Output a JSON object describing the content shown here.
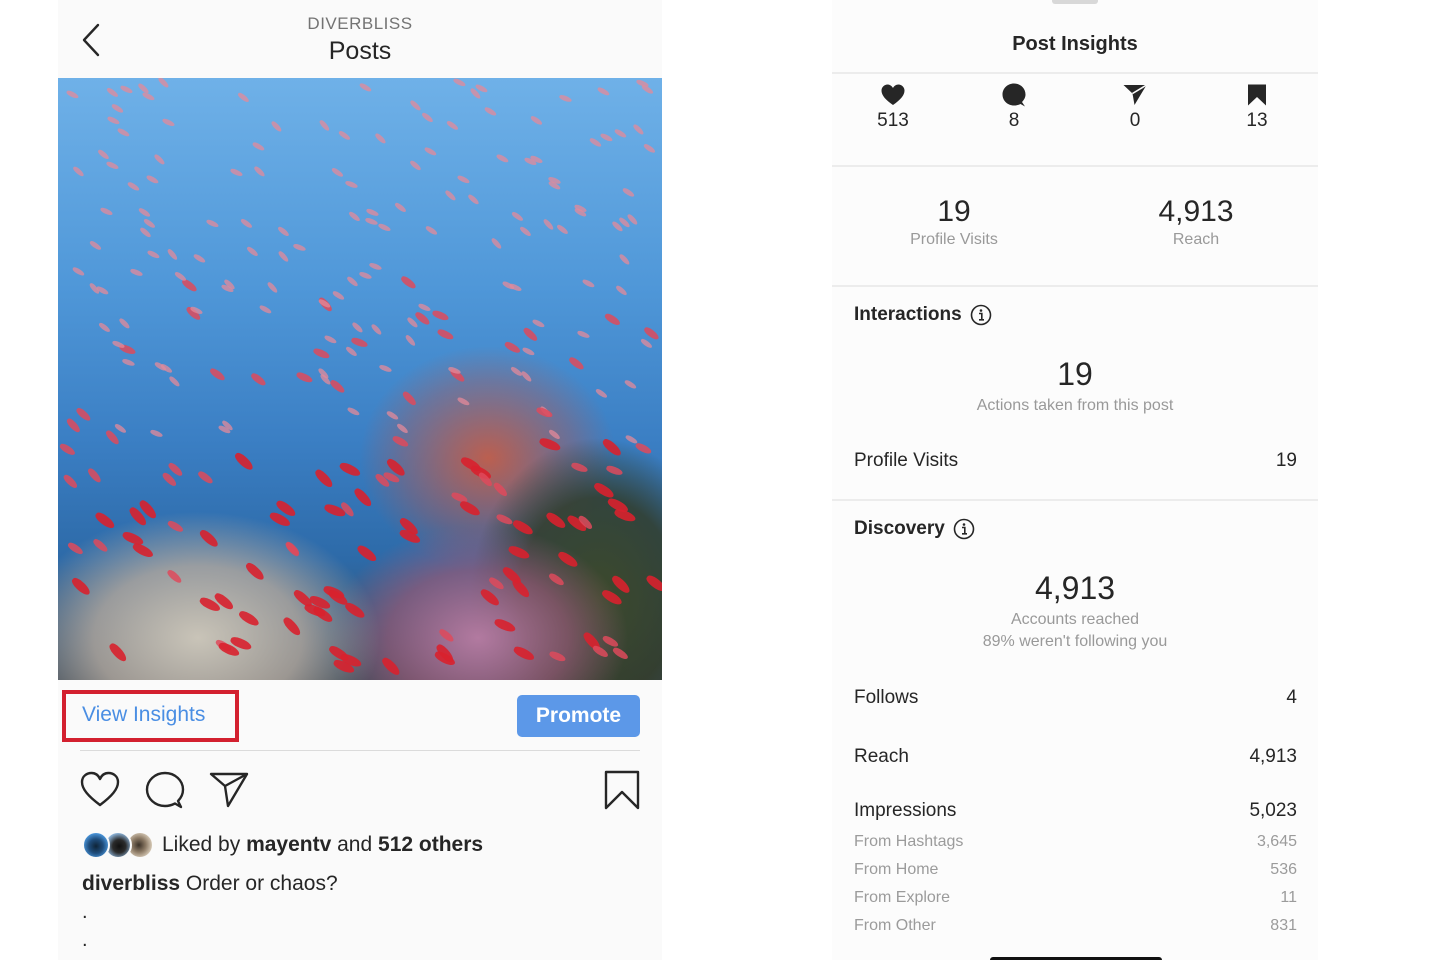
{
  "post_screen": {
    "header": {
      "username": "DIVERBLISS",
      "title": "Posts",
      "back_icon": "chevron-left-icon"
    },
    "image": {
      "description": "Underwater photo of a reef with a large school of red fish"
    },
    "view_insights_label": "View Insights",
    "promote_label": "Promote",
    "highlight_color": "#d3202f",
    "accent_color": "#5c98e8",
    "actions": {
      "like_icon": "heart-outline-icon",
      "comment_icon": "comment-outline-icon",
      "share_icon": "paper-plane-outline-icon",
      "save_icon": "bookmark-outline-icon"
    },
    "likes": {
      "prefix": "Liked by",
      "user": "mayentv",
      "conjunction": "and",
      "others": "512 others"
    },
    "caption": {
      "username": "diverbliss",
      "text": "Order or chaos?",
      "dots": [
        ".",
        "."
      ]
    }
  },
  "insights_screen": {
    "title": "Post Insights",
    "engagement": [
      {
        "icon": "heart-filled-icon",
        "value": "513"
      },
      {
        "icon": "comment-filled-icon",
        "value": "8"
      },
      {
        "icon": "paper-plane-filled-icon",
        "value": "0"
      },
      {
        "icon": "bookmark-filled-icon",
        "value": "13"
      }
    ],
    "summary": [
      {
        "value": "19",
        "label": "Profile Visits"
      },
      {
        "value": "4,913",
        "label": "Reach"
      }
    ],
    "interactions": {
      "heading": "Interactions",
      "total": "19",
      "total_label": "Actions taken from this post",
      "rows": [
        {
          "label": "Profile Visits",
          "value": "19"
        }
      ]
    },
    "discovery": {
      "heading": "Discovery",
      "total": "4,913",
      "total_label": "Accounts reached",
      "total_note": "89% weren't following you",
      "rows": [
        {
          "label": "Follows",
          "value": "4"
        },
        {
          "label": "Reach",
          "value": "4,913"
        },
        {
          "label": "Impressions",
          "value": "5,023"
        }
      ],
      "impression_sources": [
        {
          "label": "From Hashtags",
          "value": "3,645"
        },
        {
          "label": "From Home",
          "value": "536"
        },
        {
          "label": "From Explore",
          "value": "11"
        },
        {
          "label": "From Other",
          "value": "831"
        }
      ]
    }
  }
}
